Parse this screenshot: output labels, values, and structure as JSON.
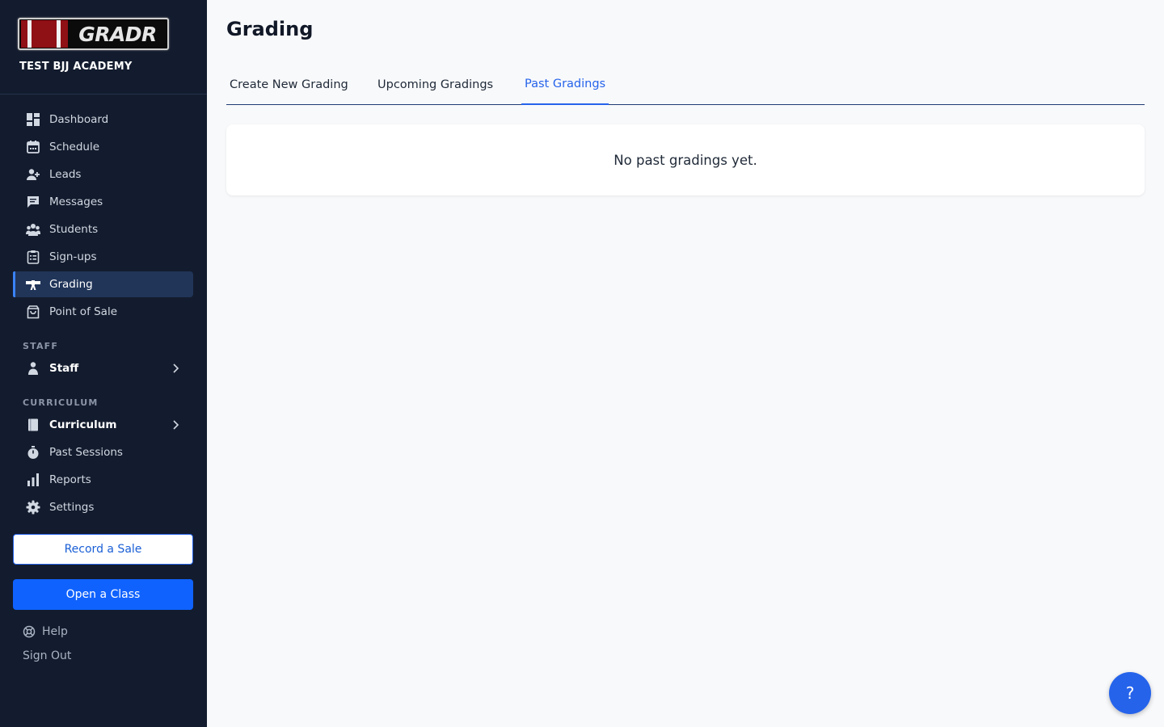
{
  "brand": {
    "logo_text": "GRADR",
    "academy": "TEST BJJ ACADEMY"
  },
  "sidebar": {
    "items": [
      {
        "label": "Dashboard",
        "icon": "dashboard-icon"
      },
      {
        "label": "Schedule",
        "icon": "calendar-icon"
      },
      {
        "label": "Leads",
        "icon": "add-person-icon"
      },
      {
        "label": "Messages",
        "icon": "chat-icon"
      },
      {
        "label": "Students",
        "icon": "group-icon"
      },
      {
        "label": "Sign-ups",
        "icon": "clipboard-icon"
      },
      {
        "label": "Grading",
        "icon": "belt-icon",
        "active": true
      },
      {
        "label": "Point of Sale",
        "icon": "shopping-bag-icon"
      }
    ],
    "staff_section": "STAFF",
    "staff": {
      "label": "Staff",
      "icon": "person-icon"
    },
    "curriculum_section": "CURRICULUM",
    "curriculum_items": [
      {
        "label": "Curriculum",
        "icon": "book-icon"
      },
      {
        "label": "Past Sessions",
        "icon": "stopwatch-icon"
      },
      {
        "label": "Reports",
        "icon": "bar-chart-icon"
      },
      {
        "label": "Settings",
        "icon": "gear-icon"
      }
    ],
    "record_sale": "Record a Sale",
    "open_class": "Open a Class",
    "help": "Help",
    "sign_out": "Sign Out"
  },
  "main": {
    "title": "Grading",
    "tabs": [
      {
        "label": "Create New Grading"
      },
      {
        "label": "Upcoming Gradings"
      },
      {
        "label": "Past Gradings",
        "active": true
      }
    ],
    "empty_message": "No past gradings yet."
  },
  "help_fab": "?",
  "colors": {
    "sidebar_bg": "#131c2e",
    "accent": "#2563eb",
    "active_bg": "#213559",
    "logo_red": "#8f1015"
  }
}
